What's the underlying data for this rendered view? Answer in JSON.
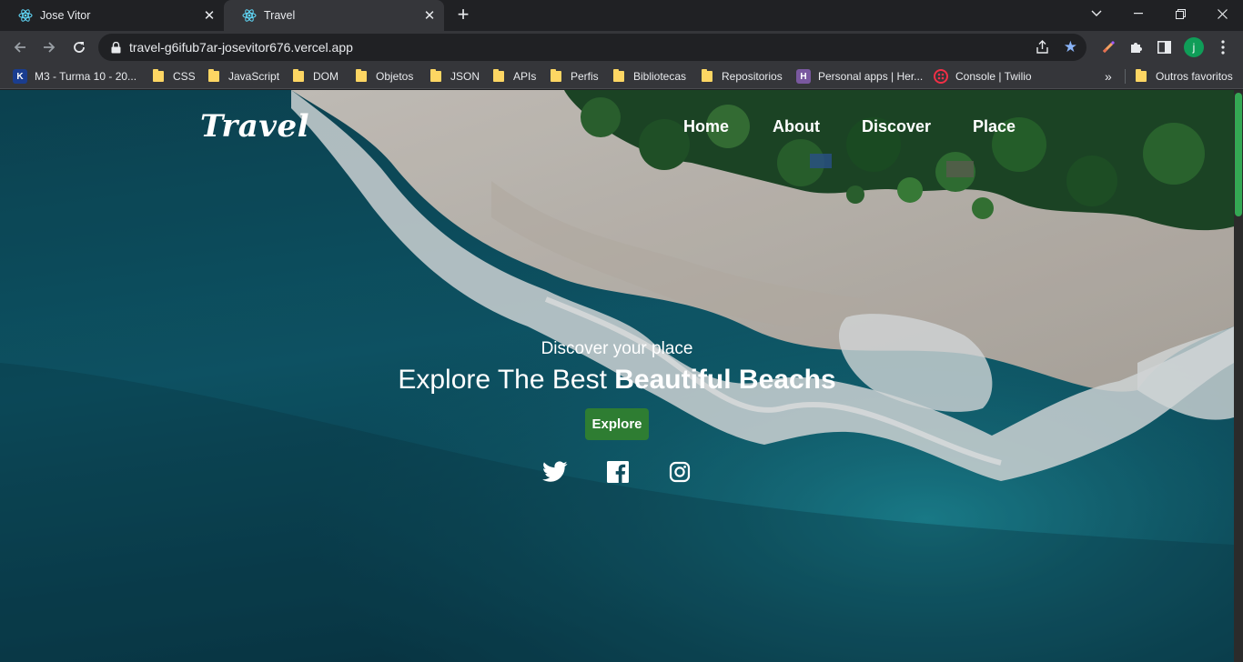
{
  "browser": {
    "tabs": [
      {
        "title": "Jose Vitor",
        "active": false
      },
      {
        "title": "Travel",
        "active": true
      }
    ],
    "url": "travel-g6ifub7ar-josevitor676.vercel.app",
    "profile_initial": "j",
    "bookmarks": [
      {
        "label": "M3 - Turma 10 - 20...",
        "icon": "site-icon"
      },
      {
        "label": "CSS",
        "icon": "folder-icon"
      },
      {
        "label": "JavaScript",
        "icon": "folder-icon"
      },
      {
        "label": "DOM",
        "icon": "folder-icon"
      },
      {
        "label": "Objetos",
        "icon": "folder-icon"
      },
      {
        "label": "JSON",
        "icon": "folder-icon"
      },
      {
        "label": "APIs",
        "icon": "folder-icon"
      },
      {
        "label": "Perfis",
        "icon": "folder-icon"
      },
      {
        "label": "Bibliotecas",
        "icon": "folder-icon"
      },
      {
        "label": "Repositorios",
        "icon": "folder-icon"
      },
      {
        "label": "Personal apps | Her...",
        "icon": "heroku-icon"
      },
      {
        "label": "Console | Twilio",
        "icon": "twilio-icon"
      }
    ],
    "more_label": "»",
    "other_bookmarks": "Outros favoritos"
  },
  "page": {
    "brand": "Travel",
    "nav": [
      "Home",
      "About",
      "Discover",
      "Place"
    ],
    "hero": {
      "subtitle": "Discover your place",
      "title_regular": "Explore The Best ",
      "title_bold": "Beautiful Beachs",
      "button": "Explore"
    },
    "social_icons": [
      "twitter-icon",
      "facebook-icon",
      "instagram-icon"
    ],
    "colors": {
      "accent": "#2e7d32",
      "scroll_thumb": "#34a853"
    }
  }
}
